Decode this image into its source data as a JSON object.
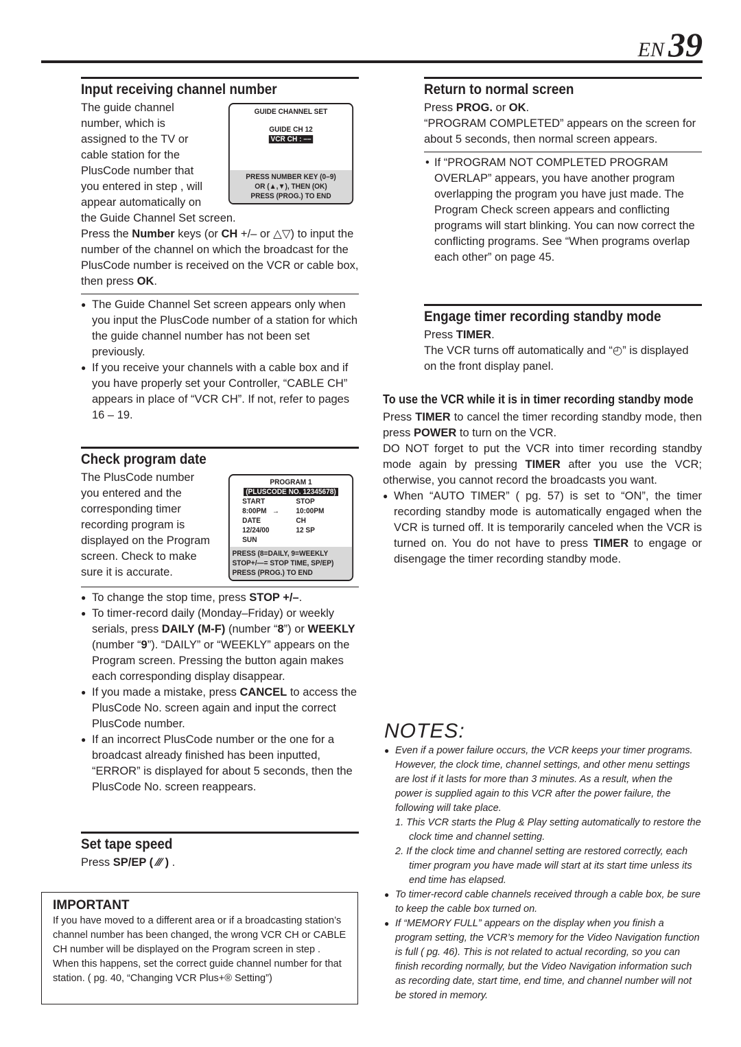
{
  "page": {
    "lang": "EN",
    "number": "39"
  },
  "input_channel": {
    "title": "Input receiving channel number",
    "intro": [
      [
        "The guide channel number, which is assigned to the TV or cable station for the PlusCode number that you entered in step    , will appear automatically on the Guide Channel Set screen.",
        0
      ]
    ],
    "press": [
      [
        "Press the ",
        0
      ],
      [
        "Number",
        1
      ],
      [
        " keys (or ",
        0
      ],
      [
        "CH",
        1
      ],
      [
        " +/– or △▽) to input the number of the channel on which the broadcast for the PlusCode number is received on the VCR or cable box, then press ",
        0
      ],
      [
        "OK",
        1
      ],
      [
        ".",
        0
      ]
    ],
    "bullets": [
      [
        [
          "The Guide Channel Set screen appears only when you input the PlusCode number of a station for which the guide channel number has not been set previously.",
          0
        ]
      ],
      [
        [
          "If you receive your channels with a cable box and if you have properly set your Controller, “CABLE CH” appears in place of “VCR CH”. If not, refer to pages 16 – 19.",
          0
        ]
      ]
    ],
    "screen": {
      "title": "GUIDE CHANNEL SET",
      "guide_ch": "GUIDE CH",
      "guide_val": "12",
      "vcr_ch": "VCR CH   : ––",
      "foot": [
        "PRESS NUMBER KEY (0–9)",
        "OR (▲,▼), THEN (OK)",
        "PRESS (PROG.) TO END"
      ]
    }
  },
  "check_date": {
    "title": "Check program date",
    "intro": [
      [
        "The PlusCode number you entered and the corresponding timer recording program is displayed on the Program screen. Check to make sure it is accurate.",
        0
      ]
    ],
    "bullets": [
      [
        [
          "To change the stop time, press ",
          0
        ],
        [
          "STOP +/–",
          1
        ],
        [
          ".",
          0
        ]
      ],
      [
        [
          "To timer-record daily (Monday–Friday) or weekly serials, press ",
          0
        ],
        [
          "DAILY (M-F)",
          1
        ],
        [
          " (number “",
          0
        ],
        [
          "8",
          1
        ],
        [
          "”) or ",
          0
        ],
        [
          "WEEKLY",
          1
        ],
        [
          " (number “",
          0
        ],
        [
          "9",
          1
        ],
        [
          "”). “DAILY” or “WEEKLY” appears on the Program screen. Pressing the button again makes each corresponding display disappear.",
          0
        ]
      ],
      [
        [
          "If you made a mistake, press ",
          0
        ],
        [
          "CANCEL",
          1
        ],
        [
          " to access the PlusCode No. screen again and input the correct PlusCode number.",
          0
        ]
      ],
      [
        [
          "If an incorrect PlusCode number or the one for a broadcast already finished has been inputted, “ERROR” is displayed for about 5 seconds, then the PlusCode No. screen reappears.",
          0
        ]
      ]
    ],
    "screen": {
      "title": "PROGRAM 1",
      "pluscode": "(PLUSCODE NO.  12345678)",
      "start": "START",
      "stop": "STOP",
      "start_time": "8:00PM",
      "arrow": "→",
      "stop_time": "10:00PM",
      "date": "DATE",
      "ch": "CH",
      "date_val": "12/24/00",
      "ch_val": "12   SP",
      "day": "SUN",
      "foot": [
        "PRESS (8=DAILY, 9=WEEKLY",
        "STOP+/—= STOP TIME, SP/EP)",
        "PRESS (PROG.) TO END"
      ]
    }
  },
  "tape_speed": {
    "title": "Set tape speed",
    "press": [
      [
        "Press ",
        0
      ],
      [
        "SP/EP ( ⁄⁄⁄ )",
        1
      ],
      [
        " .",
        0
      ]
    ]
  },
  "important": {
    "title": "IMPORTANT",
    "text": [
      [
        "If you have moved to a different area or if a broadcasting station’s channel number has been changed, the wrong VCR CH or CABLE CH number will be displayed on the Program screen in step    . When this happens, set the correct guide channel number for that station. (     pg. 40, “Changing VCR Plus+® Setting”)",
        0
      ]
    ]
  },
  "normal_screen": {
    "title": "Return to normal screen",
    "press": [
      [
        "Press ",
        0
      ],
      [
        "PROG.",
        1
      ],
      [
        " or ",
        0
      ],
      [
        "OK",
        1
      ],
      [
        ".",
        0
      ]
    ],
    "text": [
      [
        "“PROGRAM COMPLETED” appears on the screen for about 5 seconds, then normal screen appears.",
        0
      ]
    ],
    "bullet": [
      [
        "If “PROGRAM NOT COMPLETED PROGRAM OVERLAP” appears, you have another program overlapping the program you have just made. The Program Check screen appears and conflicting programs will start blinking. You can now correct the conflicting programs. See “When programs overlap each other” on page 45.",
        0
      ]
    ]
  },
  "standby": {
    "title": "Engage timer recording standby mode",
    "press": [
      [
        "Press ",
        0
      ],
      [
        "TIMER",
        1
      ],
      [
        ".",
        0
      ]
    ],
    "text": [
      [
        "The VCR turns off automatically and “◴” is displayed on the front display panel.",
        0
      ]
    ]
  },
  "use_vcr": {
    "title": "To use the VCR while it is in timer recording standby mode",
    "p1": [
      [
        "Press ",
        0
      ],
      [
        "TIMER",
        1
      ],
      [
        " to cancel the timer recording standby mode, then press ",
        0
      ],
      [
        "POWER",
        1
      ],
      [
        " to turn on the VCR.",
        0
      ]
    ],
    "p2": [
      [
        "DO NOT forget to put the VCR into timer recording standby mode again by pressing ",
        0
      ],
      [
        "TIMER",
        1
      ],
      [
        " after you use the VCR; otherwise, you cannot record the broadcasts you want.",
        0
      ]
    ],
    "bullet": [
      [
        "When “AUTO TIMER” (     pg. 57) is set to “ON”, the timer recording standby mode is automatically engaged when the VCR is turned off. It is temporarily canceled when the VCR is turned on. You do not have to press ",
        0
      ],
      [
        "TIMER",
        1
      ],
      [
        " to engage or disengage the timer recording standby mode.",
        0
      ]
    ]
  },
  "notes": {
    "title": "NOTES:",
    "b1": "Even if a power failure occurs, the VCR keeps your timer programs. However, the clock time, channel settings, and other menu settings are lost if it lasts for more than 3 minutes. As a result, when the power is supplied again to this VCR after the power failure, the following will take place.",
    "n1": "1. This VCR starts the Plug & Play setting automatically to restore the clock time and channel setting.",
    "n2": "2. If the clock time and channel setting are restored correctly, each timer program you have made will start at its start time unless its end time has elapsed.",
    "b2": "To timer-record cable channels received through a cable box, be sure to keep the cable box turned on.",
    "b3": "If “MEMORY FULL” appears on the display when you finish a program setting, the VCR’s memory for the Video Navigation function is full (     pg. 46). This is not related to actual recording, so you can finish recording normally, but the Video Navigation information such as recording date, start time, end time, and channel number will not be stored in memory."
  }
}
